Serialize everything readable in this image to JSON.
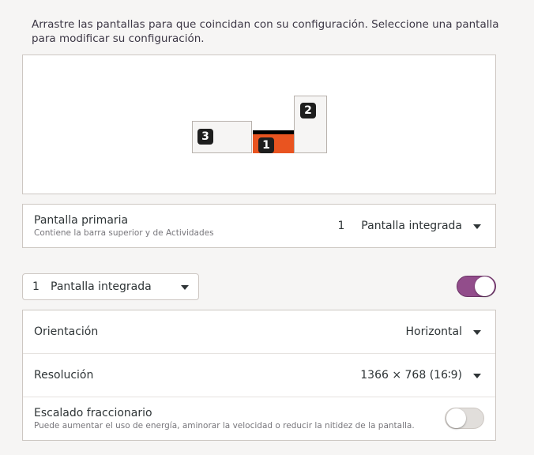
{
  "instructions": "Arrastre las pantallas para que coincidan con su configuración. Seleccione una pantalla para modificar su configuración.",
  "arrangement": {
    "monitors": [
      {
        "number": "3"
      },
      {
        "number": "1"
      },
      {
        "number": "2"
      }
    ]
  },
  "primary": {
    "title": "Pantalla primaria",
    "subtitle": "Contiene la barra superior y de Actividades",
    "value_number": "1",
    "value_name": "Pantalla integrada"
  },
  "display_selector": {
    "number": "1",
    "name": "Pantalla integrada",
    "enabled": true
  },
  "settings": {
    "orientation": {
      "label": "Orientación",
      "value": "Horizontal"
    },
    "resolution": {
      "label": "Resolución",
      "value": "1366 × 768 (16∶9)"
    },
    "fractional": {
      "label": "Escalado fraccionario",
      "description": "Puede aumentar el uso de energía, aminorar la velocidad o reducir la nitidez de la pantalla.",
      "enabled": false
    }
  },
  "colors": {
    "accent_toggle": "#924d8b",
    "monitor_primary": "#e95420"
  },
  "icons": {
    "dropdown": "chevron-down-icon"
  }
}
